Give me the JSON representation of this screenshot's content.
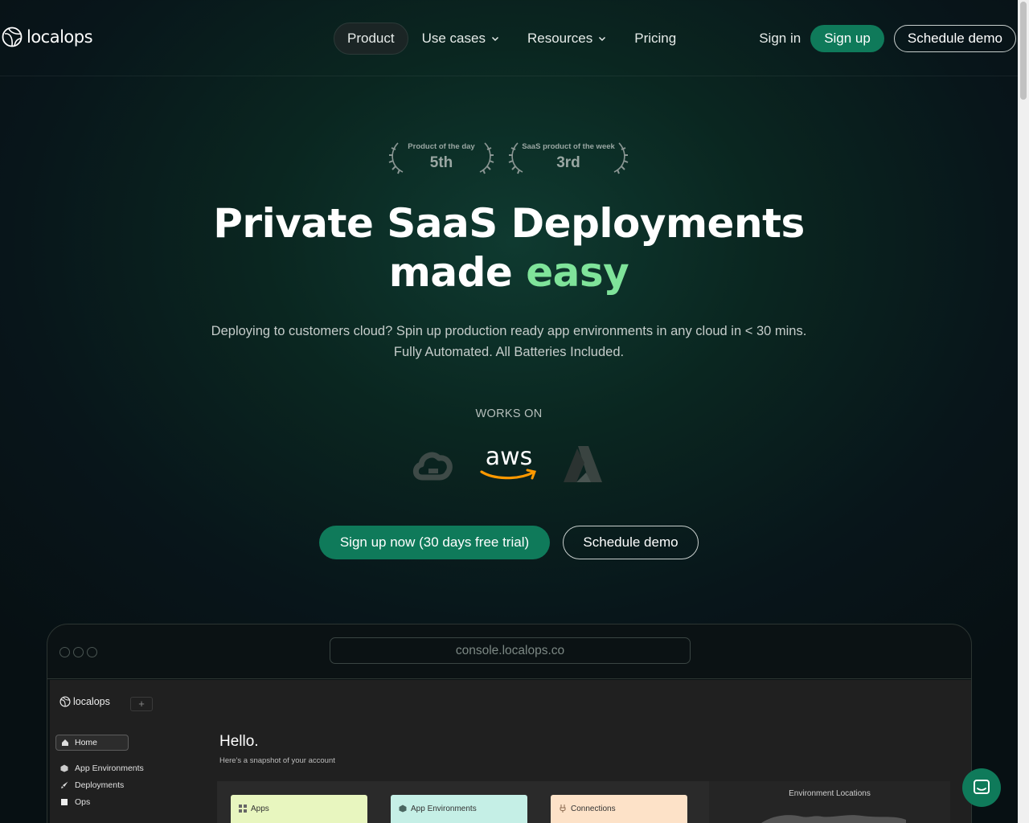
{
  "nav": {
    "logo_text": "localops",
    "links": [
      {
        "label": "Product",
        "active": true,
        "has_dropdown": false
      },
      {
        "label": "Use cases",
        "active": false,
        "has_dropdown": true
      },
      {
        "label": "Resources",
        "active": false,
        "has_dropdown": true
      },
      {
        "label": "Pricing",
        "active": false,
        "has_dropdown": false
      }
    ],
    "sign_in": "Sign in",
    "sign_up": "Sign up",
    "schedule_demo": "Schedule demo"
  },
  "awards": [
    {
      "label": "Product of the day",
      "rank": "5th"
    },
    {
      "label": "SaaS product of the week",
      "rank": "3rd"
    }
  ],
  "hero": {
    "title_line1": "Private SaaS Deployments",
    "title_line2_prefix": "made",
    "title_line2_accent": "easy",
    "subtitle_line1": "Deploying to customers cloud? Spin up production ready app environments in any cloud in < 30 mins.",
    "subtitle_line2": "Fully Automated. All Batteries Included.",
    "works_on": "WORKS ON",
    "providers": [
      {
        "name": "google-cloud-icon"
      },
      {
        "name": "aws-icon",
        "text": "aws"
      },
      {
        "name": "azure-icon"
      }
    ],
    "cta_primary": "Sign up now (30 days free trial)",
    "cta_secondary": "Schedule demo"
  },
  "preview": {
    "url": "console.localops.co",
    "app": {
      "logo_text": "localops",
      "plus": "+",
      "nav": {
        "home": "Home",
        "items": [
          "App Environments",
          "Deployments",
          "Ops"
        ]
      },
      "greeting": "Hello.",
      "snapshot": "Here's a snapshot of your account",
      "cards": [
        "Apps",
        "App Environments",
        "Connections"
      ],
      "map_title": "Environment Locations"
    }
  },
  "colors": {
    "accent_green": "#7fe39a",
    "button_green": "#0f7a5a",
    "card_apps": "#e8f6bf",
    "card_envs": "#c5efe6",
    "card_connections": "#fde2c8"
  }
}
